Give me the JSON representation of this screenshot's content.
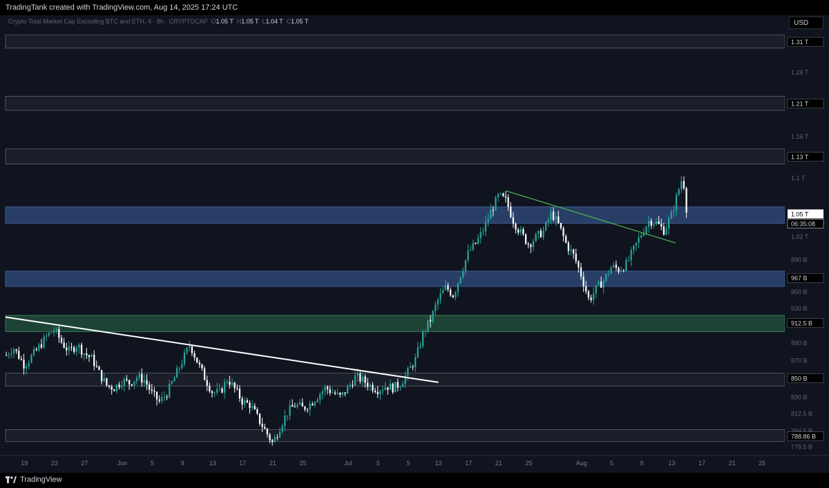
{
  "header": {
    "attribution": "TradingTank created with TradingView.com, Aug 14, 2025 17:24 UTC"
  },
  "legend": {
    "title": "Crypto Total Market Cap Excluding BTC and ETH, 4 · 8h · CRYPTOCAP",
    "o_label": "O",
    "o": "1.05 T",
    "h_label": "H",
    "h": "1.05 T",
    "l_label": "L",
    "l": "1.04 T",
    "c_label": "C",
    "c": "1.05 T"
  },
  "currency_button": "USD",
  "footer": {
    "brand": "TradingView"
  },
  "colors": {
    "bg": "#10141f",
    "up": "#26a69a",
    "down": "#ffffff",
    "zone_blue": "#2d4a7a",
    "zone_green": "#1e5a3a",
    "trend_white": "#ffffff",
    "trend_green": "#4caf50"
  },
  "chart_data": {
    "type": "candlestick",
    "interval": "8h",
    "y_scale": "log",
    "ylim": [
      770,
      1330
    ],
    "y_ticks": [
      {
        "v": 1310,
        "label": "1.31 T",
        "boxed": true
      },
      {
        "v": 1260,
        "label": "1.26 T",
        "boxed": false
      },
      {
        "v": 1210,
        "label": "1.21 T",
        "boxed": true
      },
      {
        "v": 1160,
        "label": "1.16 T",
        "boxed": false
      },
      {
        "v": 1130,
        "label": "1.13 T",
        "boxed": true
      },
      {
        "v": 1100,
        "label": "1.1 T",
        "boxed": false
      },
      {
        "v": 1050,
        "label": "1.05 T",
        "boxed": true,
        "current": true
      },
      {
        "v": 1020,
        "label": "1.02 T",
        "boxed": false
      },
      {
        "v": 990,
        "label": "990 B",
        "boxed": false
      },
      {
        "v": 967,
        "label": "967 B",
        "boxed": true
      },
      {
        "v": 950,
        "label": "950 B",
        "boxed": false
      },
      {
        "v": 930,
        "label": "930 B",
        "boxed": false
      },
      {
        "v": 912.5,
        "label": "912.5 B",
        "boxed": true
      },
      {
        "v": 890,
        "label": "890 B",
        "boxed": false
      },
      {
        "v": 870,
        "label": "870 B",
        "boxed": false
      },
      {
        "v": 850,
        "label": "850 B",
        "boxed": true
      },
      {
        "v": 830,
        "label": "830 B",
        "boxed": false
      },
      {
        "v": 812.5,
        "label": "812.5 B",
        "boxed": false
      },
      {
        "v": 794.5,
        "label": "794.5 B",
        "boxed": false
      },
      {
        "v": 788.86,
        "label": "788.86 B",
        "boxed": true
      },
      {
        "v": 778.5,
        "label": "778.5 B",
        "boxed": false
      }
    ],
    "countdown": "06:35:08",
    "x_ticks": [
      {
        "d": 0,
        "label": "19"
      },
      {
        "d": 4,
        "label": "23"
      },
      {
        "d": 8,
        "label": "27"
      },
      {
        "d": 13,
        "label": "Jun"
      },
      {
        "d": 17,
        "label": "5"
      },
      {
        "d": 21,
        "label": "9"
      },
      {
        "d": 25,
        "label": "13"
      },
      {
        "d": 29,
        "label": "17"
      },
      {
        "d": 33,
        "label": "21"
      },
      {
        "d": 37,
        "label": "25"
      },
      {
        "d": 43,
        "label": "Jul"
      },
      {
        "d": 47,
        "label": "5"
      },
      {
        "d": 51,
        "label": "9"
      },
      {
        "d": 55,
        "label": "13"
      },
      {
        "d": 59,
        "label": "17"
      },
      {
        "d": 63,
        "label": "21"
      },
      {
        "d": 67,
        "label": "25"
      },
      {
        "d": 74,
        "label": "Aug"
      },
      {
        "d": 78,
        "label": "5"
      },
      {
        "d": 82,
        "label": "9"
      },
      {
        "d": 86,
        "label": "13"
      },
      {
        "d": 90,
        "label": "17"
      },
      {
        "d": 94,
        "label": "21"
      },
      {
        "d": 98,
        "label": "25"
      }
    ],
    "x_range_days": [
      -2.5,
      101
    ],
    "price_path": [
      [
        -2.5,
        875
      ],
      [
        -1.5,
        885
      ],
      [
        0,
        865
      ],
      [
        1.5,
        880
      ],
      [
        3,
        898
      ],
      [
        4,
        905
      ],
      [
        5,
        890
      ],
      [
        6,
        880
      ],
      [
        7,
        888
      ],
      [
        8,
        878
      ],
      [
        9,
        872
      ],
      [
        10,
        855
      ],
      [
        11,
        842
      ],
      [
        12,
        840
      ],
      [
        13,
        848
      ],
      [
        14,
        845
      ],
      [
        15,
        852
      ],
      [
        16,
        848
      ],
      [
        17,
        833
      ],
      [
        18,
        825
      ],
      [
        19,
        835
      ],
      [
        20,
        852
      ],
      [
        21,
        870
      ],
      [
        22,
        888
      ],
      [
        23,
        868
      ],
      [
        24,
        850
      ],
      [
        25,
        835
      ],
      [
        26,
        835
      ],
      [
        27,
        850
      ],
      [
        28,
        838
      ],
      [
        29,
        825
      ],
      [
        30,
        822
      ],
      [
        31,
        808
      ],
      [
        32,
        795
      ],
      [
        33,
        782
      ],
      [
        34,
        800
      ],
      [
        35,
        815
      ],
      [
        36,
        822
      ],
      [
        37,
        818
      ],
      [
        38,
        823
      ],
      [
        39,
        832
      ],
      [
        40,
        840
      ],
      [
        41,
        835
      ],
      [
        42,
        830
      ],
      [
        43,
        840
      ],
      [
        44,
        852
      ],
      [
        45,
        848
      ],
      [
        46,
        842
      ],
      [
        47,
        838
      ],
      [
        48,
        842
      ],
      [
        49,
        840
      ],
      [
        50,
        845
      ],
      [
        51,
        858
      ],
      [
        52,
        872
      ],
      [
        53,
        902
      ],
      [
        54,
        918
      ],
      [
        55,
        942
      ],
      [
        56,
        956
      ],
      [
        57,
        946
      ],
      [
        58,
        974
      ],
      [
        59,
        1000
      ],
      [
        60,
        1012
      ],
      [
        61,
        1030
      ],
      [
        62,
        1055
      ],
      [
        63,
        1075
      ],
      [
        64,
        1068
      ],
      [
        65,
        1040
      ],
      [
        66,
        1024
      ],
      [
        67,
        1010
      ],
      [
        68,
        1020
      ],
      [
        69,
        1028
      ],
      [
        70,
        1052
      ],
      [
        71,
        1035
      ],
      [
        72,
        1010
      ],
      [
        73,
        995
      ],
      [
        74,
        970
      ],
      [
        75,
        940
      ],
      [
        76,
        955
      ],
      [
        77,
        965
      ],
      [
        78,
        982
      ],
      [
        79,
        978
      ],
      [
        80,
        985
      ],
      [
        81,
        1005
      ],
      [
        82,
        1025
      ],
      [
        83,
        1042
      ],
      [
        84,
        1038
      ],
      [
        85,
        1028
      ],
      [
        86,
        1050
      ],
      [
        86.8,
        1080
      ],
      [
        87.3,
        1098
      ],
      [
        87.7,
        1088
      ],
      [
        88,
        1050
      ]
    ],
    "zones": [
      {
        "lo": 1300,
        "hi": 1322,
        "kind": "grey"
      },
      {
        "lo": 1200,
        "hi": 1222,
        "kind": "grey"
      },
      {
        "lo": 1120,
        "hi": 1142,
        "kind": "grey"
      },
      {
        "lo": 1038,
        "hi": 1060,
        "kind": "blue"
      },
      {
        "lo": 957,
        "hi": 976,
        "kind": "blue"
      },
      {
        "lo": 903,
        "hi": 922,
        "kind": "green"
      },
      {
        "lo": 842,
        "hi": 856,
        "kind": "grey"
      },
      {
        "lo": 784,
        "hi": 796,
        "kind": "grey"
      }
    ],
    "trendlines": [
      {
        "d1": -2.5,
        "v1": 920,
        "d2": 55,
        "v2": 846,
        "color": "trend_white",
        "width": 2
      },
      {
        "d1": 64,
        "v1": 1082,
        "d2": 86.5,
        "v2": 1012,
        "color": "trend_green",
        "width": 1.3
      }
    ]
  }
}
